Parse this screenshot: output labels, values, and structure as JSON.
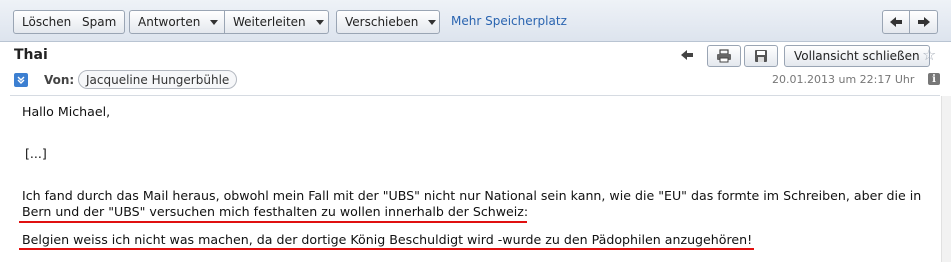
{
  "toolbar": {
    "delete_label": "Löschen",
    "spam_label": "Spam",
    "reply_label": "Antworten",
    "forward_label": "Weiterleiten",
    "move_label": "Verschieben",
    "more_storage_label": "Mehr Speicherplatz"
  },
  "header": {
    "subject": "Thai",
    "full_view_label": "Vollansicht schließen",
    "from_label": "Von:",
    "sender": "Jacqueline Hungerbühle",
    "datetime": "20.01.2013 um 22:17 Uhr"
  },
  "body": {
    "greeting": "Hallo Michael,",
    "ellipsis": "[...]",
    "line1": "Ich fand durch das Mail heraus, obwohl mein Fall mit der \"UBS\" nicht nur National sein kann, wie die \"EU\" das formte im Schreiben, aber die in",
    "line2": "Bern und der \"UBS\" versuchen mich festhalten zu wollen innerhalb der Schweiz:",
    "line3": "Belgien weiss ich nicht was machen, da der dortige König Beschuldigt wird -wurde zu den Pädophilen anzugehören!"
  },
  "colors": {
    "link": "#2a64b0",
    "underline": "#e01010",
    "toolbar_bg": "#dde4ee"
  },
  "icons": [
    "arrow-left-icon",
    "arrow-right-icon",
    "reply-arrow-icon",
    "print-icon",
    "save-icon",
    "star-icon",
    "expand-icon",
    "info-icon",
    "dropdown-caret-icon"
  ]
}
